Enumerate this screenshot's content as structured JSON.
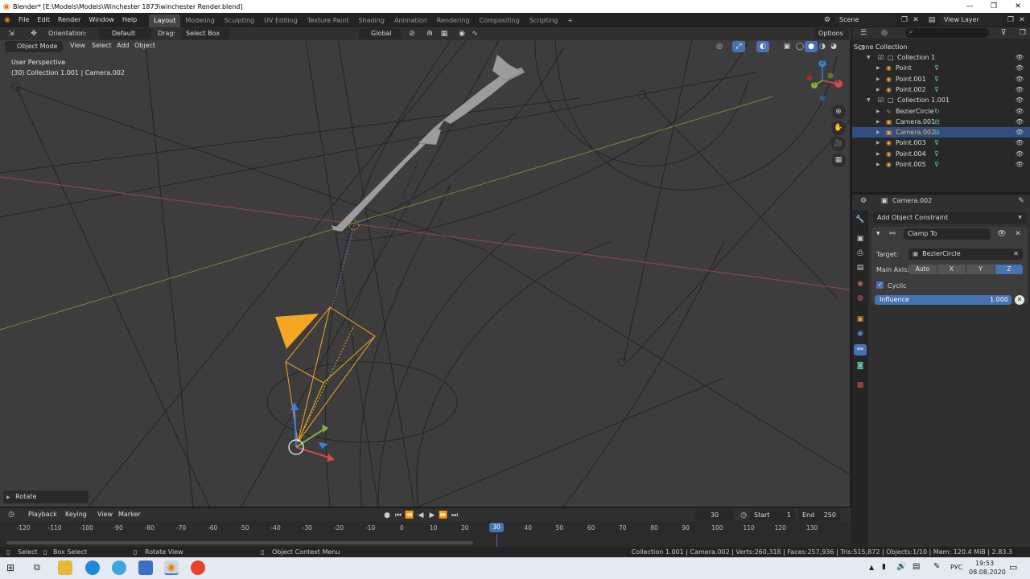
{
  "window": {
    "title": "Blender* [E:\\Models\\Models\\Winchester 1873\\winchester Render.blend]"
  },
  "menu": [
    "File",
    "Edit",
    "Render",
    "Window",
    "Help"
  ],
  "workspaces": [
    "Layout",
    "Modeling",
    "Sculpting",
    "UV Editing",
    "Texture Paint",
    "Shading",
    "Animation",
    "Rendering",
    "Compositing",
    "Scripting"
  ],
  "active_workspace": "Layout",
  "scene": {
    "name": "Scene",
    "view_layer": "View Layer"
  },
  "tool_header": {
    "orientation_label": "Orientation:",
    "orientation_value": "Default",
    "drag_label": "Drag:",
    "drag_value": "Select Box",
    "transform_orientation": "Global",
    "options": "Options"
  },
  "viewport_header": {
    "mode": "Object Mode",
    "menus": [
      "View",
      "Select",
      "Add",
      "Object"
    ]
  },
  "viewport": {
    "perspective": "User Perspective",
    "context": "(30) Collection 1.001 | Camera.002",
    "last_op": "Rotate",
    "gizmo_axes": [
      "X",
      "Y",
      "Z"
    ]
  },
  "outliner": {
    "root": "Scene Collection",
    "rows": [
      {
        "label": "Collection 1",
        "level": 1,
        "type": "collection"
      },
      {
        "label": "Point",
        "level": 2,
        "type": "light"
      },
      {
        "label": "Point.001",
        "level": 2,
        "type": "light"
      },
      {
        "label": "Point.002",
        "level": 2,
        "type": "light"
      },
      {
        "label": "Collection 1.001",
        "level": 1,
        "type": "collection"
      },
      {
        "label": "BezierCircle",
        "level": 2,
        "type": "curve"
      },
      {
        "label": "Camera.001",
        "level": 2,
        "type": "camera"
      },
      {
        "label": "Camera.002",
        "level": 2,
        "type": "camera",
        "selected": true
      },
      {
        "label": "Point.003",
        "level": 2,
        "type": "light"
      },
      {
        "label": "Point.004",
        "level": 2,
        "type": "light"
      },
      {
        "label": "Point.005",
        "level": 2,
        "type": "light"
      }
    ]
  },
  "properties": {
    "object_name": "Camera.002",
    "add_constraint": "Add Object Constraint",
    "constraint_name": "Clamp To",
    "target_label": "Target:",
    "target_value": "BezierCircle",
    "main_axis_label": "Main Axis:",
    "axes": [
      "Auto",
      "X",
      "Y",
      "Z"
    ],
    "active_axis": "Z",
    "cyclic_label": "Cyclic",
    "cyclic": true,
    "influence_label": "Influence",
    "influence_value": "1.000",
    "influence": 1.0
  },
  "timeline": {
    "menus": [
      "Playback",
      "Keying",
      "View",
      "Marker"
    ],
    "current_frame": "30",
    "start_label": "Start",
    "start": "1",
    "end_label": "End",
    "end": "250",
    "ticks": [
      "-120",
      "-110",
      "-100",
      "-90",
      "-80",
      "-70",
      "-60",
      "-50",
      "-40",
      "-30",
      "-20",
      "-10",
      "0",
      "10",
      "20",
      "30",
      "40",
      "50",
      "60",
      "70",
      "80",
      "90",
      "100",
      "110",
      "120",
      "130"
    ],
    "current": 30
  },
  "statusbar": {
    "select": "Select",
    "box_select": "Box Select",
    "rotate_view": "Rotate View",
    "context_menu": "Object Context Menu",
    "stats": "Collection 1.001 | Camera.002 | Verts:260,318 | Faces:257,936 | Tris:515,872 | Objects:1/10 | Mem: 120.4 MiB | 2.83.3"
  },
  "taskbar": {
    "lang": "РУС",
    "time": "19:53",
    "date": "08.08.2020"
  },
  "colors": {
    "accent_blue": "#4772b3",
    "selection_orange": "#f5a623",
    "viewport_bg": "#3d3d3d",
    "axis_x": "#d64a4a",
    "axis_y": "#88b040",
    "axis_z": "#3a7fe0"
  }
}
